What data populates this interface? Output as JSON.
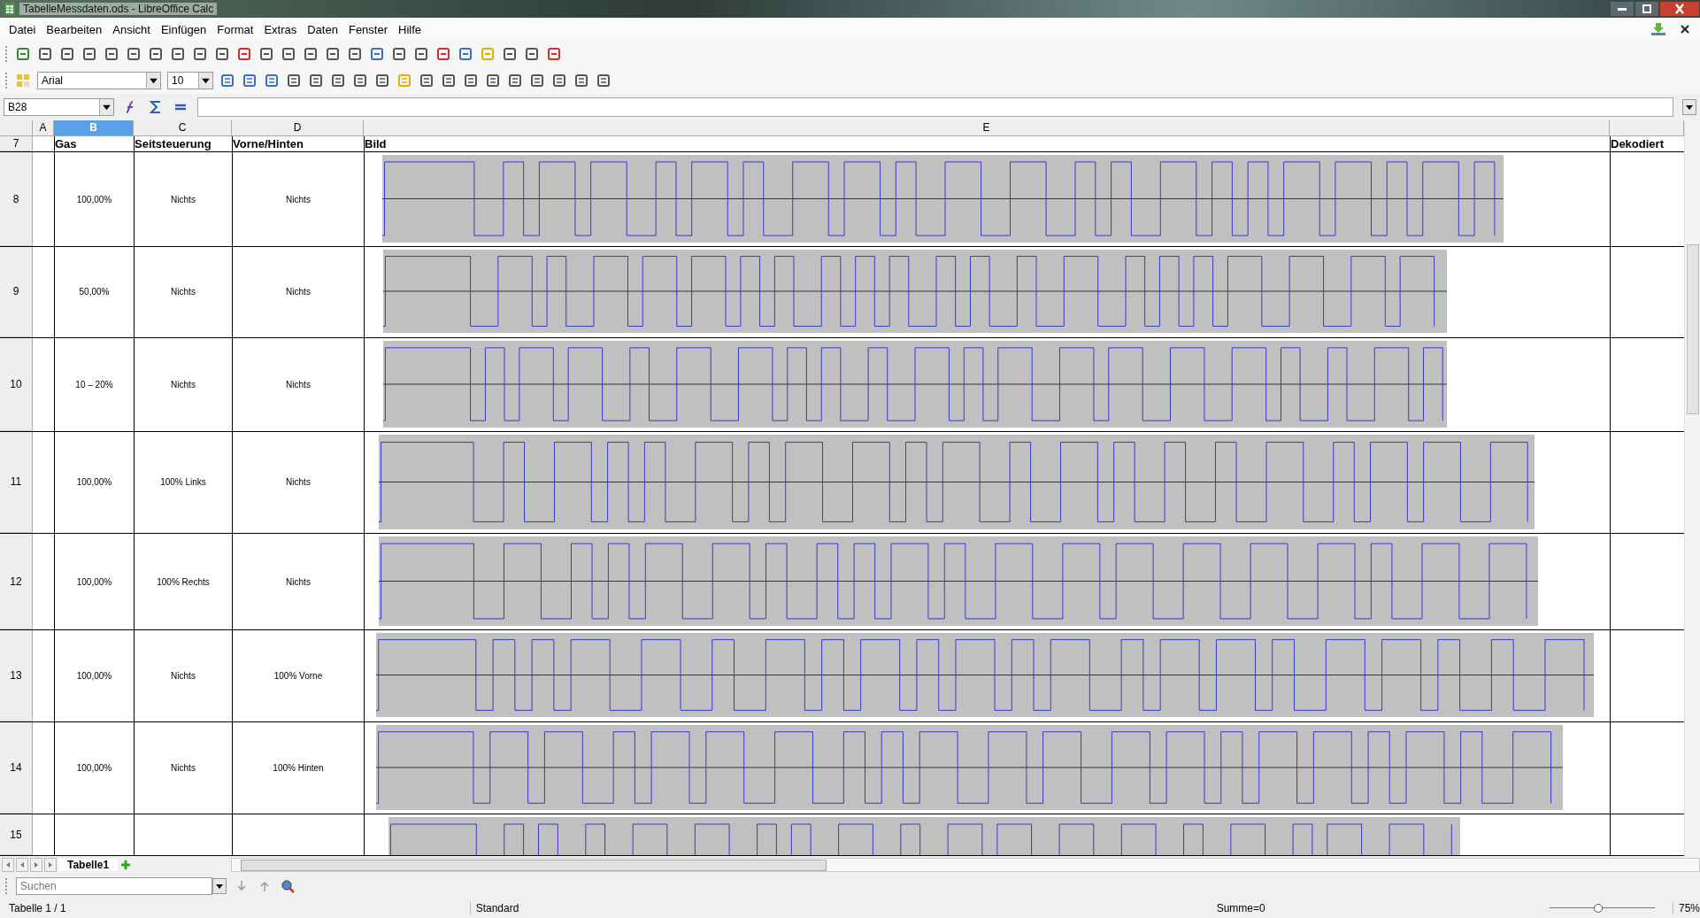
{
  "window": {
    "title": "TabelleMessdaten.ods - LibreOffice Calc"
  },
  "menu": [
    "Datei",
    "Bearbeiten",
    "Ansicht",
    "Einfügen",
    "Format",
    "Extras",
    "Daten",
    "Fenster",
    "Hilfe"
  ],
  "font_box": {
    "font": "Arial",
    "size": "10"
  },
  "formula_bar": {
    "cell_ref": "B28"
  },
  "columns": [
    {
      "label": "A",
      "selected": false
    },
    {
      "label": "B",
      "selected": true
    },
    {
      "label": "C",
      "selected": false
    },
    {
      "label": "D",
      "selected": false
    },
    {
      "label": "E",
      "selected": false
    }
  ],
  "header_row": {
    "number": "7",
    "cells": [
      "Gas",
      "Seitsteuerung",
      "Vorne/Hinten",
      "Bild",
      "Dekodiert"
    ]
  },
  "rows": [
    {
      "number": "8",
      "gas": "100,00%",
      "seitsteuerung": "Nichts",
      "vorne_hinten": "Nichts"
    },
    {
      "number": "9",
      "gas": "50,00%",
      "seitsteuerung": "Nichts",
      "vorne_hinten": "Nichts"
    },
    {
      "number": "10",
      "gas": "10 – 20%",
      "seitsteuerung": "Nichts",
      "vorne_hinten": "Nichts"
    },
    {
      "number": "11",
      "gas": "100,00%",
      "seitsteuerung": "100% Links",
      "vorne_hinten": "Nichts"
    },
    {
      "number": "12",
      "gas": "100,00%",
      "seitsteuerung": "100% Rechts",
      "vorne_hinten": "Nichts"
    },
    {
      "number": "13",
      "gas": "100,00%",
      "seitsteuerung": "Nichts",
      "vorne_hinten": "100% Vorne"
    },
    {
      "number": "14",
      "gas": "100,00%",
      "seitsteuerung": "Nichts",
      "vorne_hinten": "100% Hinten"
    },
    {
      "number": "15"
    }
  ],
  "sheet_tabs": [
    {
      "label": "Tabelle1",
      "selected": true
    }
  ],
  "find_bar": {
    "placeholder": "Suchen"
  },
  "status_bar": {
    "sheet": "Tabelle 1 / 1",
    "style": "Standard",
    "sum": "Summe=0",
    "zoom": "75%",
    "zoom_slider": {
      "level": 0.45
    }
  }
}
